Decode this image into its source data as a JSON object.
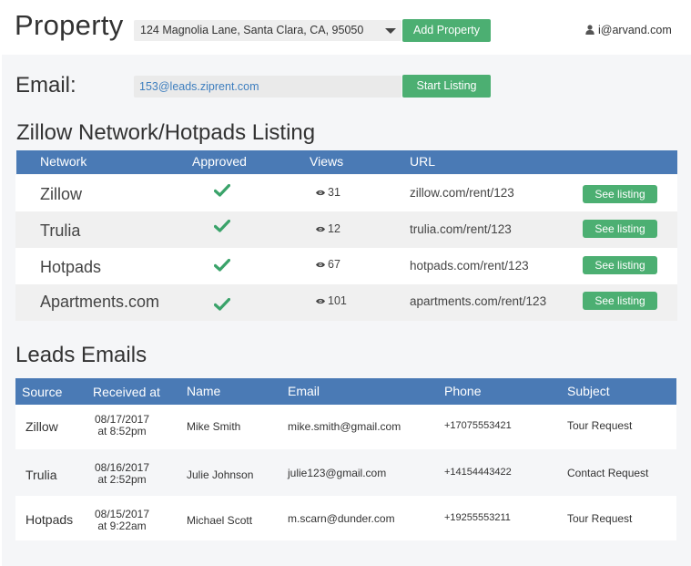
{
  "header": {
    "title": "Property",
    "property_selected": "124 Magnolia Lane, Santa Clara, CA, 95050",
    "add_property_label": "Add Property",
    "user_email": "i@arvand.com"
  },
  "email_section": {
    "label": "Email:",
    "value": "153@leads.ziprent.com",
    "start_listing_label": "Start Listing"
  },
  "listing_section": {
    "title": "Zillow Network/Hotpads Listing",
    "columns": [
      "Network",
      "Approved",
      "Views",
      "URL"
    ],
    "rows": [
      {
        "network": "Zillow",
        "views": "31",
        "url": "zillow.com/rent/123",
        "action": "See listing"
      },
      {
        "network": "Trulia",
        "views": "12",
        "url": "trulia.com/rent/123",
        "action": "See listing"
      },
      {
        "network": "Hotpads",
        "views": "67",
        "url": "hotpads.com/rent/123",
        "action": "See listing"
      },
      {
        "network": "Apartments.com",
        "views": "101",
        "url": "apartments.com/rent/123",
        "action": "See listing"
      }
    ]
  },
  "leads_section": {
    "title": "Leads Emails",
    "columns": [
      "Source",
      "Received at",
      "Name",
      "Email",
      "Phone",
      "Subject"
    ],
    "rows": [
      {
        "source": "Zillow",
        "date": "08/17/2017",
        "time": "at 8:52pm",
        "name": "Mike Smith",
        "email": "mike.smith@gmail.com",
        "phone": "+17075553421",
        "subject": "Tour Request"
      },
      {
        "source": "Trulia",
        "date": "08/16/2017",
        "time": "at 2:52pm",
        "name": "Julie Johnson",
        "email": "julie123@gmail.com",
        "phone": "+14154443422",
        "subject": "Contact Request"
      },
      {
        "source": "Hotpads",
        "date": "08/15/2017",
        "time": "at 9:22am",
        "name": "Michael Scott",
        "email": "m.scarn@dunder.com",
        "phone": "+19255553211",
        "subject": "Tour Request"
      }
    ]
  },
  "colors": {
    "header_blue": "#4a7ab5",
    "button_green": "#4caf72",
    "check_green": "#3aa36a",
    "link_blue": "#3f7fbf"
  },
  "icons": [
    "caret-down-icon",
    "user-icon",
    "check-icon",
    "eye-icon"
  ]
}
